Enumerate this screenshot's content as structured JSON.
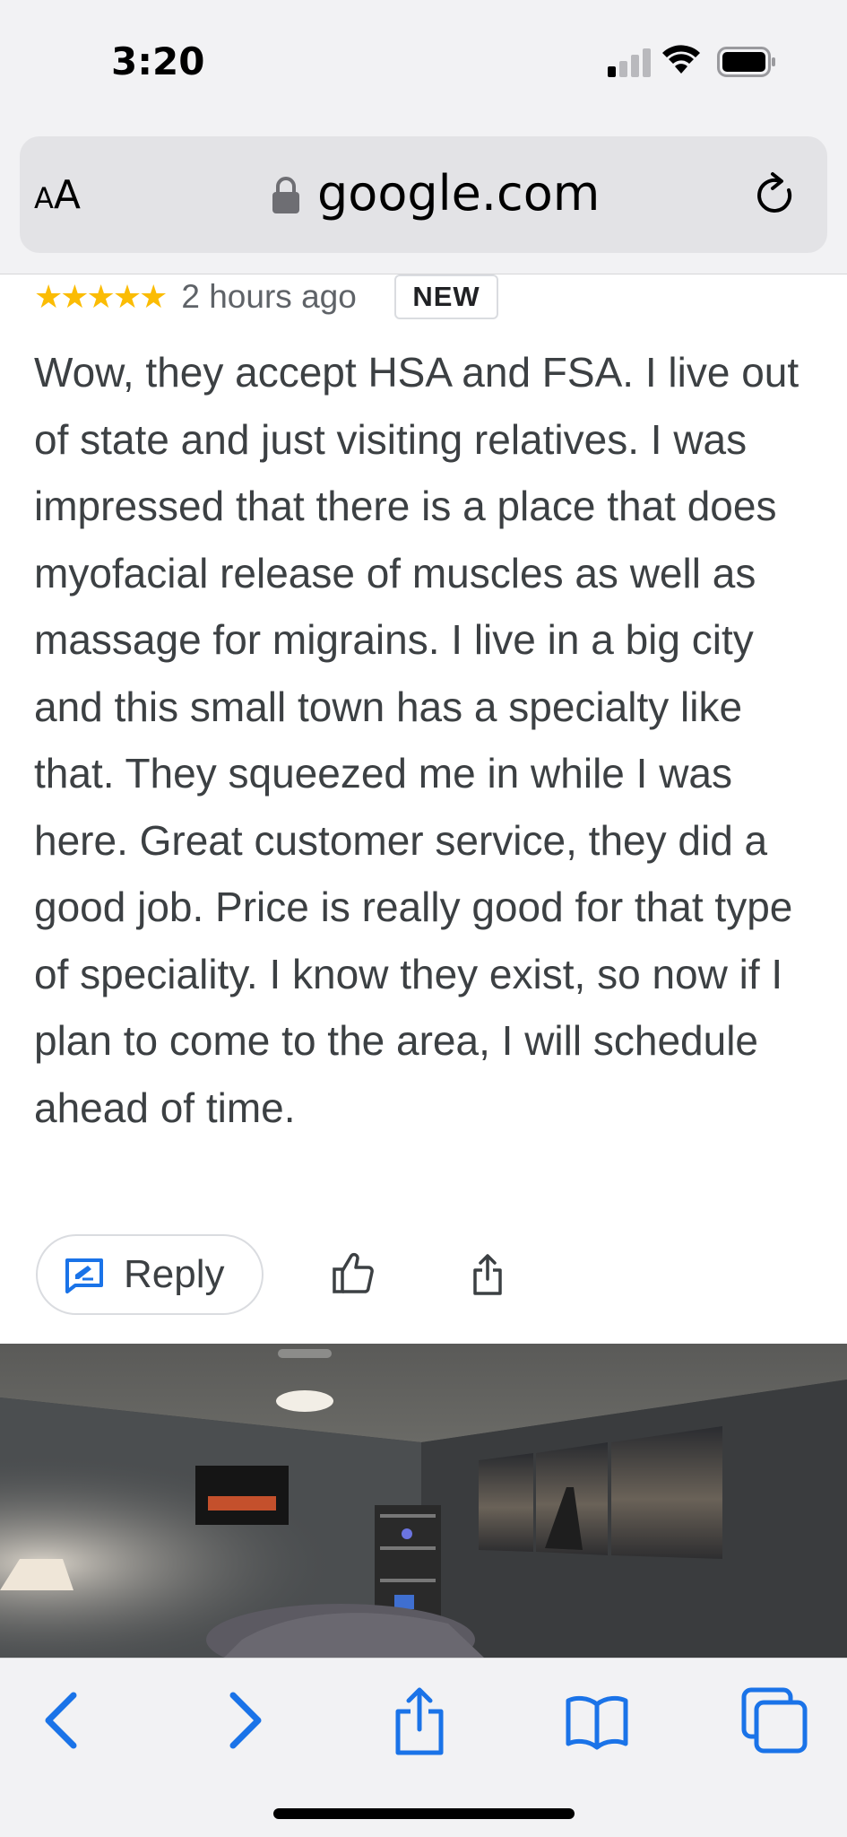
{
  "status_bar": {
    "time": "3:20"
  },
  "browser": {
    "aa_label_small": "A",
    "aa_label_large": "A",
    "url": "google.com"
  },
  "review": {
    "stars": "★★★★★",
    "rating": 5,
    "time_ago": "2 hours ago",
    "badge": "NEW",
    "text": "Wow, they accept HSA and FSA. I live out of state and just visiting relatives. I was impressed that there is a place that does myofacial release of muscles as well as massage for migrains. I live in a big city and this small town has a specialty like that. They squeezed me in while I was here. Great customer service, they did a good job. Price is really good for that type of speciality. I know they exist, so now if I plan to come to the area, I will schedule ahead of time.",
    "reply_label": "Reply"
  },
  "colors": {
    "accent": "#1a73e8",
    "star": "#fbbc04",
    "ios_blue": "#1a73e8"
  },
  "icons": {
    "reply": "reply-edit-icon",
    "like": "thumbs-up-icon",
    "share": "share-icon",
    "back": "chevron-left-icon",
    "forward": "chevron-right-icon",
    "toolbar_share": "share-icon",
    "bookmarks": "book-icon",
    "tabs": "tabs-icon"
  }
}
